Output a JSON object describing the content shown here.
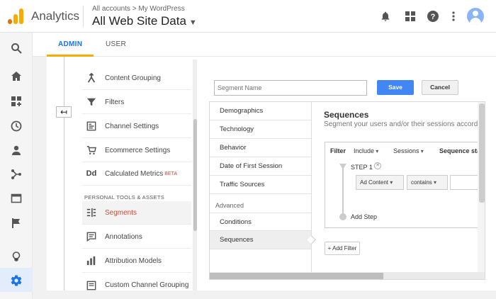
{
  "app": {
    "title": "Analytics"
  },
  "header": {
    "breadcrumb": "All accounts > My WordPress",
    "account_view": "All Web Site Data",
    "icons": [
      "bell-icon",
      "apps-grid-icon",
      "help-icon",
      "more-vert-icon",
      "avatar"
    ]
  },
  "tabs": [
    {
      "label": "ADMIN",
      "active": true
    },
    {
      "label": "USER",
      "active": false
    }
  ],
  "left_nav": [
    "search-icon",
    "home-icon",
    "customization-icon",
    "realtime-clock-icon",
    "audience-person-icon",
    "acquisition-icon",
    "behavior-icon",
    "conversions-flag-icon",
    "discover-bulb-icon",
    "admin-gear-icon"
  ],
  "menu": {
    "items": [
      {
        "label": "Content Grouping",
        "icon": "content-grouping-icon"
      },
      {
        "label": "Filters",
        "icon": "filter-icon"
      },
      {
        "label": "Channel Settings",
        "icon": "channel-settings-icon"
      },
      {
        "label": "Ecommerce Settings",
        "icon": "cart-icon"
      },
      {
        "label": "Calculated Metrics",
        "icon": "dd-icon",
        "badge": "BETA"
      }
    ],
    "section_title": "PERSONAL TOOLS & ASSETS",
    "tools": [
      {
        "label": "Segments",
        "icon": "segments-icon",
        "active": true
      },
      {
        "label": "Annotations",
        "icon": "annotations-icon"
      },
      {
        "label": "Attribution Models",
        "icon": "bar-chart-icon"
      },
      {
        "label": "Custom Channel Grouping",
        "icon": "custom-channel-icon"
      }
    ]
  },
  "segment_editor": {
    "name_placeholder": "Segment Name",
    "save_label": "Save",
    "cancel_label": "Cancel",
    "categories": [
      "Demographics",
      "Technology",
      "Behavior",
      "Date of First Session",
      "Traffic Sources"
    ],
    "advanced_label": "Advanced",
    "advanced_items": [
      "Conditions",
      "Sequences"
    ],
    "selected": "Sequences",
    "sequences": {
      "title": "Sequences",
      "subtitle": "Segment your users and/or their sessions accord",
      "filter_label": "Filter",
      "include_label": "Include",
      "sessions_label": "Sessions",
      "sequence_start_label": "Sequence sta",
      "step_label": "STEP 1",
      "dimension": "Ad Content",
      "operator": "contains",
      "add_step_label": "Add Step",
      "add_filter_label": "+ Add Filter"
    }
  },
  "colors": {
    "accent": "#1a73e8",
    "tab_underline": "#f9ab00",
    "save_button": "#4285f4",
    "active_item": "#d14836",
    "logo_orange": "#f9ab00",
    "logo_dark_orange": "#e37400"
  }
}
